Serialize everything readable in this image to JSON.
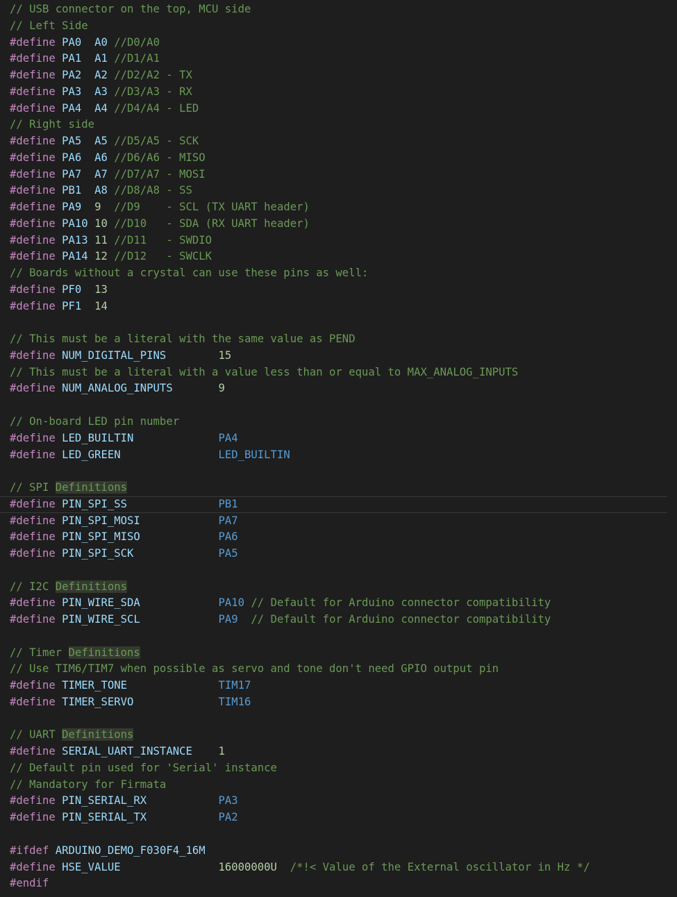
{
  "editor": {
    "language": "c",
    "theme": {
      "background": "#1e1e1e",
      "comment": "#6a9955",
      "directive": "#c586c0",
      "macro": "#9cdcfe",
      "value": "#569cd6",
      "number": "#b5cea8",
      "text": "#d4d4d4",
      "highlight": "#343a2f"
    },
    "current_line": 30,
    "lines": [
      [
        {
          "t": "c",
          "v": "// USB connector on the top, MCU side"
        }
      ],
      [
        {
          "t": "c",
          "v": "// Left Side"
        }
      ],
      [
        {
          "t": "d",
          "v": "#define"
        },
        {
          "t": "s",
          "v": " "
        },
        {
          "t": "m",
          "v": "PA0"
        },
        {
          "t": "s",
          "v": "  "
        },
        {
          "t": "m",
          "v": "A0"
        },
        {
          "t": "s",
          "v": " "
        },
        {
          "t": "c",
          "v": "//D0/A0"
        }
      ],
      [
        {
          "t": "d",
          "v": "#define"
        },
        {
          "t": "s",
          "v": " "
        },
        {
          "t": "m",
          "v": "PA1"
        },
        {
          "t": "s",
          "v": "  "
        },
        {
          "t": "m",
          "v": "A1"
        },
        {
          "t": "s",
          "v": " "
        },
        {
          "t": "c",
          "v": "//D1/A1"
        }
      ],
      [
        {
          "t": "d",
          "v": "#define"
        },
        {
          "t": "s",
          "v": " "
        },
        {
          "t": "m",
          "v": "PA2"
        },
        {
          "t": "s",
          "v": "  "
        },
        {
          "t": "m",
          "v": "A2"
        },
        {
          "t": "s",
          "v": " "
        },
        {
          "t": "c",
          "v": "//D2/A2 - TX"
        }
      ],
      [
        {
          "t": "d",
          "v": "#define"
        },
        {
          "t": "s",
          "v": " "
        },
        {
          "t": "m",
          "v": "PA3"
        },
        {
          "t": "s",
          "v": "  "
        },
        {
          "t": "m",
          "v": "A3"
        },
        {
          "t": "s",
          "v": " "
        },
        {
          "t": "c",
          "v": "//D3/A3 - RX"
        }
      ],
      [
        {
          "t": "d",
          "v": "#define"
        },
        {
          "t": "s",
          "v": " "
        },
        {
          "t": "m",
          "v": "PA4"
        },
        {
          "t": "s",
          "v": "  "
        },
        {
          "t": "m",
          "v": "A4"
        },
        {
          "t": "s",
          "v": " "
        },
        {
          "t": "c",
          "v": "//D4/A4 - LED"
        }
      ],
      [
        {
          "t": "c",
          "v": "// Right side"
        }
      ],
      [
        {
          "t": "d",
          "v": "#define"
        },
        {
          "t": "s",
          "v": " "
        },
        {
          "t": "m",
          "v": "PA5"
        },
        {
          "t": "s",
          "v": "  "
        },
        {
          "t": "m",
          "v": "A5"
        },
        {
          "t": "s",
          "v": " "
        },
        {
          "t": "c",
          "v": "//D5/A5 - SCK"
        }
      ],
      [
        {
          "t": "d",
          "v": "#define"
        },
        {
          "t": "s",
          "v": " "
        },
        {
          "t": "m",
          "v": "PA6"
        },
        {
          "t": "s",
          "v": "  "
        },
        {
          "t": "m",
          "v": "A6"
        },
        {
          "t": "s",
          "v": " "
        },
        {
          "t": "c",
          "v": "//D6/A6 - MISO"
        }
      ],
      [
        {
          "t": "d",
          "v": "#define"
        },
        {
          "t": "s",
          "v": " "
        },
        {
          "t": "m",
          "v": "PA7"
        },
        {
          "t": "s",
          "v": "  "
        },
        {
          "t": "m",
          "v": "A7"
        },
        {
          "t": "s",
          "v": " "
        },
        {
          "t": "c",
          "v": "//D7/A7 - MOSI"
        }
      ],
      [
        {
          "t": "d",
          "v": "#define"
        },
        {
          "t": "s",
          "v": " "
        },
        {
          "t": "m",
          "v": "PB1"
        },
        {
          "t": "s",
          "v": "  "
        },
        {
          "t": "m",
          "v": "A8"
        },
        {
          "t": "s",
          "v": " "
        },
        {
          "t": "c",
          "v": "//D8/A8 - SS"
        }
      ],
      [
        {
          "t": "d",
          "v": "#define"
        },
        {
          "t": "s",
          "v": " "
        },
        {
          "t": "m",
          "v": "PA9"
        },
        {
          "t": "s",
          "v": "  "
        },
        {
          "t": "n",
          "v": "9"
        },
        {
          "t": "s",
          "v": "  "
        },
        {
          "t": "c",
          "v": "//D9    - SCL (TX UART header)"
        }
      ],
      [
        {
          "t": "d",
          "v": "#define"
        },
        {
          "t": "s",
          "v": " "
        },
        {
          "t": "m",
          "v": "PA10"
        },
        {
          "t": "s",
          "v": " "
        },
        {
          "t": "n",
          "v": "10"
        },
        {
          "t": "s",
          "v": " "
        },
        {
          "t": "c",
          "v": "//D10   - SDA (RX UART header)"
        }
      ],
      [
        {
          "t": "d",
          "v": "#define"
        },
        {
          "t": "s",
          "v": " "
        },
        {
          "t": "m",
          "v": "PA13"
        },
        {
          "t": "s",
          "v": " "
        },
        {
          "t": "n",
          "v": "11"
        },
        {
          "t": "s",
          "v": " "
        },
        {
          "t": "c",
          "v": "//D11   - SWDIO"
        }
      ],
      [
        {
          "t": "d",
          "v": "#define"
        },
        {
          "t": "s",
          "v": " "
        },
        {
          "t": "m",
          "v": "PA14"
        },
        {
          "t": "s",
          "v": " "
        },
        {
          "t": "n",
          "v": "12"
        },
        {
          "t": "s",
          "v": " "
        },
        {
          "t": "c",
          "v": "//D12   - SWCLK"
        }
      ],
      [
        {
          "t": "c",
          "v": "// Boards without a crystal can use these pins as well:"
        }
      ],
      [
        {
          "t": "d",
          "v": "#define"
        },
        {
          "t": "s",
          "v": " "
        },
        {
          "t": "m",
          "v": "PF0"
        },
        {
          "t": "s",
          "v": "  "
        },
        {
          "t": "n",
          "v": "13"
        }
      ],
      [
        {
          "t": "d",
          "v": "#define"
        },
        {
          "t": "s",
          "v": " "
        },
        {
          "t": "m",
          "v": "PF1"
        },
        {
          "t": "s",
          "v": "  "
        },
        {
          "t": "n",
          "v": "14"
        }
      ],
      [],
      [
        {
          "t": "c",
          "v": "// This must be a literal with the same value as PEND"
        }
      ],
      [
        {
          "t": "d",
          "v": "#define"
        },
        {
          "t": "s",
          "v": " "
        },
        {
          "t": "m",
          "v": "NUM_DIGITAL_PINS"
        },
        {
          "t": "s",
          "v": "        "
        },
        {
          "t": "n",
          "v": "15"
        }
      ],
      [
        {
          "t": "c",
          "v": "// This must be a literal with a value less than or equal to MAX_ANALOG_INPUTS"
        }
      ],
      [
        {
          "t": "d",
          "v": "#define"
        },
        {
          "t": "s",
          "v": " "
        },
        {
          "t": "m",
          "v": "NUM_ANALOG_INPUTS"
        },
        {
          "t": "s",
          "v": "       "
        },
        {
          "t": "n",
          "v": "9"
        }
      ],
      [],
      [
        {
          "t": "c",
          "v": "// On-board LED pin number"
        }
      ],
      [
        {
          "t": "d",
          "v": "#define"
        },
        {
          "t": "s",
          "v": " "
        },
        {
          "t": "m",
          "v": "LED_BUILTIN"
        },
        {
          "t": "s",
          "v": "             "
        },
        {
          "t": "v",
          "v": "PA4"
        }
      ],
      [
        {
          "t": "d",
          "v": "#define"
        },
        {
          "t": "s",
          "v": " "
        },
        {
          "t": "m",
          "v": "LED_GREEN"
        },
        {
          "t": "s",
          "v": "               "
        },
        {
          "t": "v",
          "v": "LED_BUILTIN"
        }
      ],
      [],
      [
        {
          "t": "c",
          "v": "// SPI "
        },
        {
          "t": "h",
          "v": "Definitions"
        }
      ],
      [
        {
          "t": "d",
          "v": "#define"
        },
        {
          "t": "s",
          "v": " "
        },
        {
          "t": "m",
          "v": "PIN_SPI_SS"
        },
        {
          "t": "s",
          "v": "              "
        },
        {
          "t": "v",
          "v": "PB1"
        }
      ],
      [
        {
          "t": "d",
          "v": "#define"
        },
        {
          "t": "s",
          "v": " "
        },
        {
          "t": "m",
          "v": "PIN_SPI_MOSI"
        },
        {
          "t": "s",
          "v": "            "
        },
        {
          "t": "v",
          "v": "PA7"
        }
      ],
      [
        {
          "t": "d",
          "v": "#define"
        },
        {
          "t": "s",
          "v": " "
        },
        {
          "t": "m",
          "v": "PIN_SPI_MISO"
        },
        {
          "t": "s",
          "v": "            "
        },
        {
          "t": "v",
          "v": "PA6"
        }
      ],
      [
        {
          "t": "d",
          "v": "#define"
        },
        {
          "t": "s",
          "v": " "
        },
        {
          "t": "m",
          "v": "PIN_SPI_SCK"
        },
        {
          "t": "s",
          "v": "             "
        },
        {
          "t": "v",
          "v": "PA5"
        }
      ],
      [],
      [
        {
          "t": "c",
          "v": "// I2C "
        },
        {
          "t": "h",
          "v": "Definitions"
        }
      ],
      [
        {
          "t": "d",
          "v": "#define"
        },
        {
          "t": "s",
          "v": " "
        },
        {
          "t": "m",
          "v": "PIN_WIRE_SDA"
        },
        {
          "t": "s",
          "v": "            "
        },
        {
          "t": "v",
          "v": "PA10"
        },
        {
          "t": "s",
          "v": " "
        },
        {
          "t": "c",
          "v": "// Default for Arduino connector compatibility"
        }
      ],
      [
        {
          "t": "d",
          "v": "#define"
        },
        {
          "t": "s",
          "v": " "
        },
        {
          "t": "m",
          "v": "PIN_WIRE_SCL"
        },
        {
          "t": "s",
          "v": "            "
        },
        {
          "t": "v",
          "v": "PA9"
        },
        {
          "t": "s",
          "v": "  "
        },
        {
          "t": "c",
          "v": "// Default for Arduino connector compatibility"
        }
      ],
      [],
      [
        {
          "t": "c",
          "v": "// Timer "
        },
        {
          "t": "h",
          "v": "Definitions"
        }
      ],
      [
        {
          "t": "c",
          "v": "// Use TIM6/TIM7 when possible as servo and tone don't need GPIO output pin"
        }
      ],
      [
        {
          "t": "d",
          "v": "#define"
        },
        {
          "t": "s",
          "v": " "
        },
        {
          "t": "m",
          "v": "TIMER_TONE"
        },
        {
          "t": "s",
          "v": "              "
        },
        {
          "t": "v",
          "v": "TIM17"
        }
      ],
      [
        {
          "t": "d",
          "v": "#define"
        },
        {
          "t": "s",
          "v": " "
        },
        {
          "t": "m",
          "v": "TIMER_SERVO"
        },
        {
          "t": "s",
          "v": "             "
        },
        {
          "t": "v",
          "v": "TIM16"
        }
      ],
      [],
      [
        {
          "t": "c",
          "v": "// UART "
        },
        {
          "t": "h",
          "v": "Definitions"
        }
      ],
      [
        {
          "t": "d",
          "v": "#define"
        },
        {
          "t": "s",
          "v": " "
        },
        {
          "t": "m",
          "v": "SERIAL_UART_INSTANCE"
        },
        {
          "t": "s",
          "v": "    "
        },
        {
          "t": "n",
          "v": "1"
        }
      ],
      [
        {
          "t": "c",
          "v": "// Default pin used for 'Serial' instance"
        }
      ],
      [
        {
          "t": "c",
          "v": "// Mandatory for Firmata"
        }
      ],
      [
        {
          "t": "d",
          "v": "#define"
        },
        {
          "t": "s",
          "v": " "
        },
        {
          "t": "m",
          "v": "PIN_SERIAL_RX"
        },
        {
          "t": "s",
          "v": "           "
        },
        {
          "t": "v",
          "v": "PA3"
        }
      ],
      [
        {
          "t": "d",
          "v": "#define"
        },
        {
          "t": "s",
          "v": " "
        },
        {
          "t": "m",
          "v": "PIN_SERIAL_TX"
        },
        {
          "t": "s",
          "v": "           "
        },
        {
          "t": "v",
          "v": "PA2"
        }
      ],
      [],
      [
        {
          "t": "d",
          "v": "#ifdef"
        },
        {
          "t": "s",
          "v": " "
        },
        {
          "t": "m",
          "v": "ARDUINO_DEMO_F030F4_16M"
        }
      ],
      [
        {
          "t": "d",
          "v": "#define"
        },
        {
          "t": "s",
          "v": " "
        },
        {
          "t": "m",
          "v": "HSE_VALUE"
        },
        {
          "t": "s",
          "v": "               "
        },
        {
          "t": "n",
          "v": "16000000U"
        },
        {
          "t": "s",
          "v": "  "
        },
        {
          "t": "c",
          "v": "/*!< Value of the External oscillator in Hz */"
        }
      ],
      [
        {
          "t": "d",
          "v": "#endif"
        }
      ]
    ]
  }
}
